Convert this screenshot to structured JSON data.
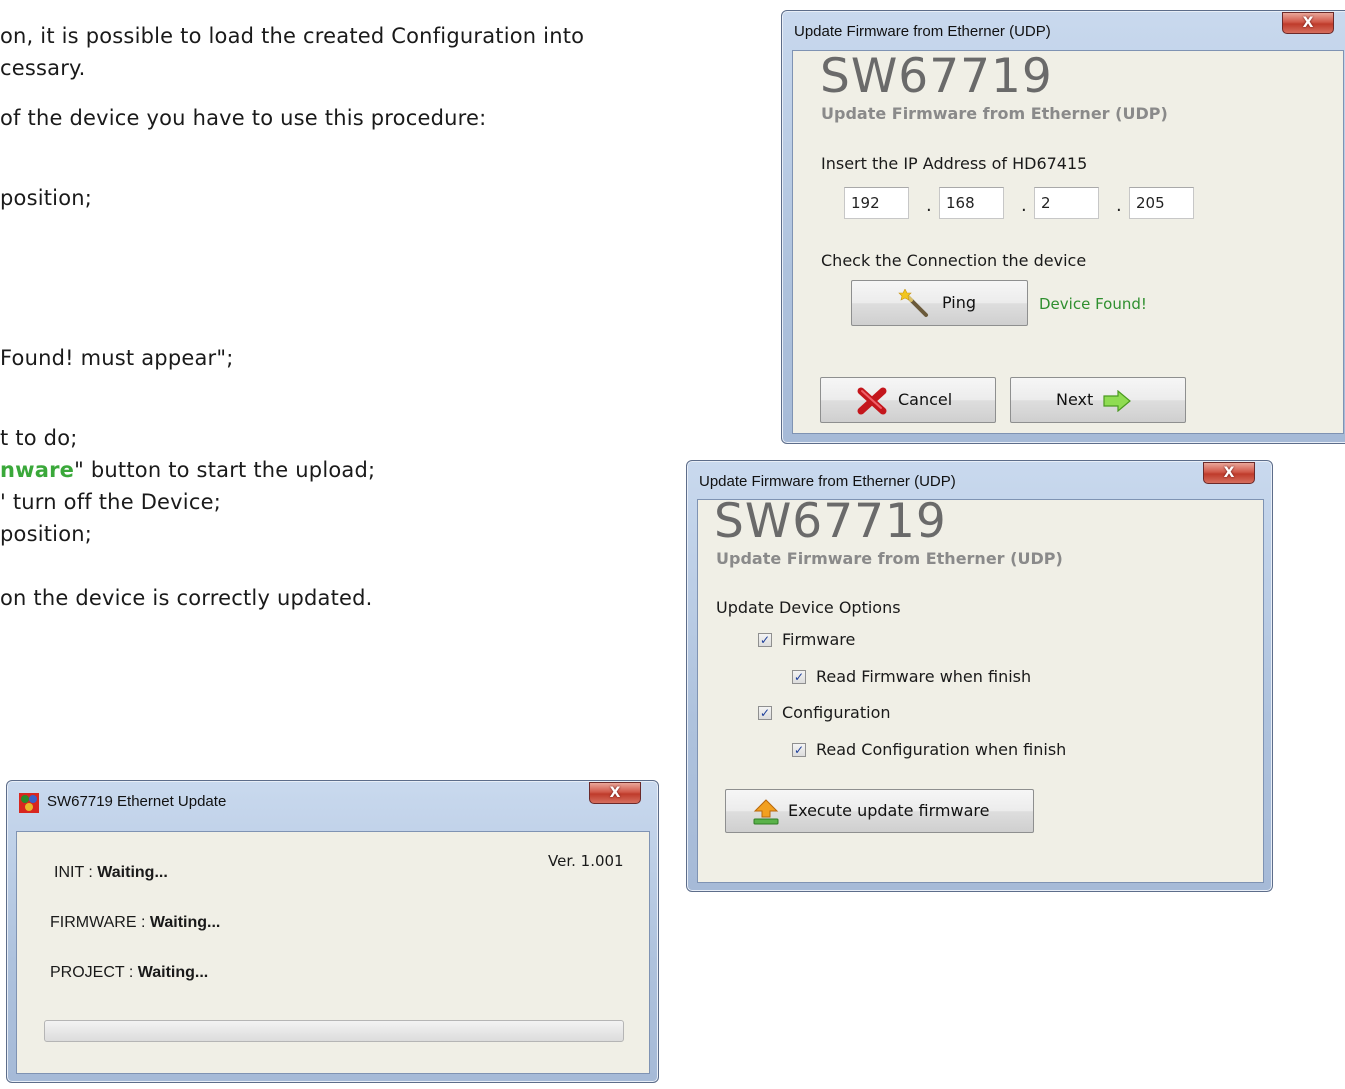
{
  "doc": {
    "line1": "on, it is possible to load the created Configuration into",
    "line2": "cessary.",
    "line3": "of the device you have to use this procedure:",
    "line4": "position;",
    "line5": " Found! must appear\";",
    "line6": "t to do;",
    "line7_bold": "nware",
    "line7_rest": "\" button to start the upload;",
    "line8": "' turn off the Device;",
    "line9": " position;",
    "line10": " on the device is correctly updated."
  },
  "dialog_ip": {
    "title": "Update Firmware from Etherner (UDP)",
    "close": "X",
    "heading": "SW67719",
    "subheading": "Update Firmware from Etherner (UDP)",
    "ip_label": "Insert the IP Address of HD67415",
    "ip": [
      "192",
      "168",
      "2",
      "205"
    ],
    "dot": ".",
    "check_label": "Check the Connection the device",
    "ping_label": "Ping",
    "status": "Device Found!",
    "cancel_label": "Cancel",
    "next_label": "Next"
  },
  "dialog_options": {
    "title": "Update Firmware from Etherner (UDP)",
    "close": "X",
    "heading": "SW67719",
    "subheading": "Update Firmware from Etherner (UDP)",
    "options_label": "Update Device Options",
    "options": [
      {
        "label": "Firmware",
        "checked": true
      },
      {
        "label": "Read Firmware when finish",
        "checked": true
      },
      {
        "label": "Configuration",
        "checked": true
      },
      {
        "label": "Read Configuration when finish",
        "checked": true
      }
    ],
    "execute_label": "Execute update firmware"
  },
  "dialog_progress": {
    "title": "SW67719 Ethernet Update",
    "close": "X",
    "version": "Ver. 1.001",
    "init_label": "INIT : ",
    "init_value": "Waiting...",
    "firmware_label": "FIRMWARE : ",
    "firmware_value": "Waiting...",
    "project_label": "PROJECT : ",
    "project_value": "Waiting...",
    "progress": 0
  }
}
